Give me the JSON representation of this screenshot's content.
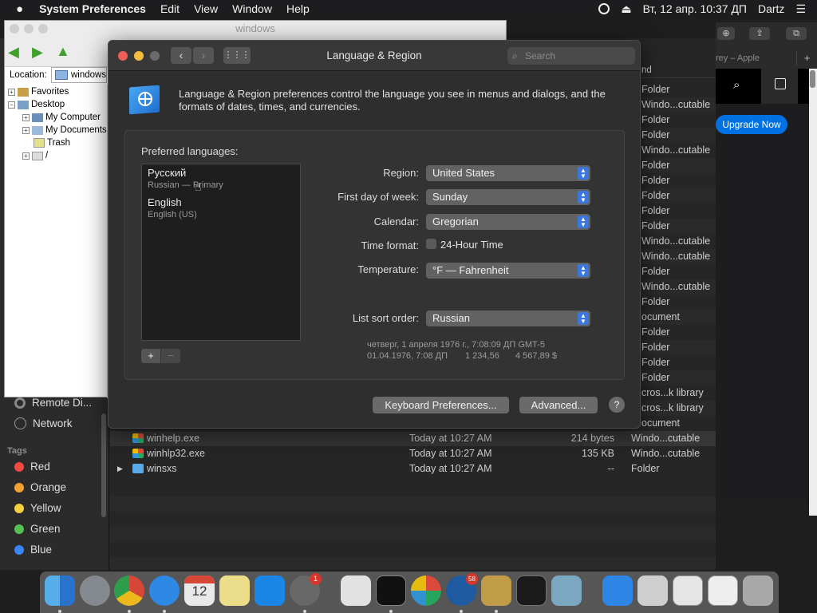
{
  "menubar": {
    "app_name": "System Preferences",
    "items": [
      "Edit",
      "View",
      "Window",
      "Help"
    ],
    "clock": "Вт, 12 апр.  10:37 ДП",
    "user": "Dartz"
  },
  "explorer": {
    "title": "windows",
    "location_label": "Location:",
    "location_value": "windows",
    "tree": [
      "Favorites",
      "Desktop",
      "My Computer",
      "My Documents",
      "Trash",
      "/"
    ]
  },
  "finder": {
    "sidebar": {
      "items": [
        "Remote Di...",
        "Network"
      ],
      "tags_header": "Tags",
      "tags": [
        {
          "label": "Red",
          "color": "#f24a42"
        },
        {
          "label": "Orange",
          "color": "#f3a133"
        },
        {
          "label": "Yellow",
          "color": "#f4d03a"
        },
        {
          "label": "Green",
          "color": "#55c152"
        },
        {
          "label": "Blue",
          "color": "#3a86f5"
        }
      ]
    },
    "kind_header": "nd",
    "kinds": [
      "Folder",
      "Windo...cutable",
      "Folder",
      "Folder",
      "Windo...cutable",
      "Folder",
      "Folder",
      "Folder",
      "Folder",
      "Folder",
      "Windo...cutable",
      "Windo...cutable",
      "Folder",
      "Windo...cutable",
      "Folder",
      "ocument",
      "Folder",
      "Folder",
      "Folder",
      "Folder",
      "cros...k library",
      "cros...k library",
      "ocument"
    ],
    "rows": [
      {
        "name": "winhelp.exe",
        "date": "Today at 10:27 AM",
        "size": "214 bytes",
        "kind": "Windo...cutable"
      },
      {
        "name": "winhlp32.exe",
        "date": "Today at 10:27 AM",
        "size": "135 KB",
        "kind": "Windo...cutable"
      },
      {
        "name": "winsxs",
        "date": "Today at 10:27 AM",
        "size": "--",
        "kind": "Folder"
      }
    ]
  },
  "safari": {
    "tab_label": "rey – Apple",
    "upgrade_label": "Upgrade Now"
  },
  "language_region": {
    "title": "Language & Region",
    "search_placeholder": "Search",
    "description": "Language & Region preferences control the language you see in menus and dialogs, and the formats of dates, times, and currencies.",
    "preferred_languages_label": "Preferred languages:",
    "languages": [
      {
        "name": "Русский",
        "detail": "Russian — Primary"
      },
      {
        "name": "English",
        "detail": "English (US)"
      }
    ],
    "add_label": "+",
    "remove_label": "−",
    "region_label": "Region:",
    "region_value": "United States",
    "first_day_label": "First day of week:",
    "first_day_value": "Sunday",
    "calendar_label": "Calendar:",
    "calendar_value": "Gregorian",
    "time_format_label": "Time format:",
    "time_format_option": "24-Hour Time",
    "time_format_checked": false,
    "temperature_label": "Temperature:",
    "temperature_value": "°F — Fahrenheit",
    "list_sort_label": "List sort order:",
    "list_sort_value": "Russian",
    "sample_date_long": "четверг, 1 апреля 1976 г., 7:08:09 ДП GMT-5",
    "sample_date_short": "01.04.1976, 7:08 ДП",
    "sample_number": "1 234,56",
    "sample_currency": "4 567,89 $",
    "keyboard_prefs_label": "Keyboard Preferences...",
    "advanced_label": "Advanced...",
    "help_label": "?"
  },
  "dock": {
    "badges": {
      "system_prefs": "1",
      "quicktime": "58"
    }
  }
}
